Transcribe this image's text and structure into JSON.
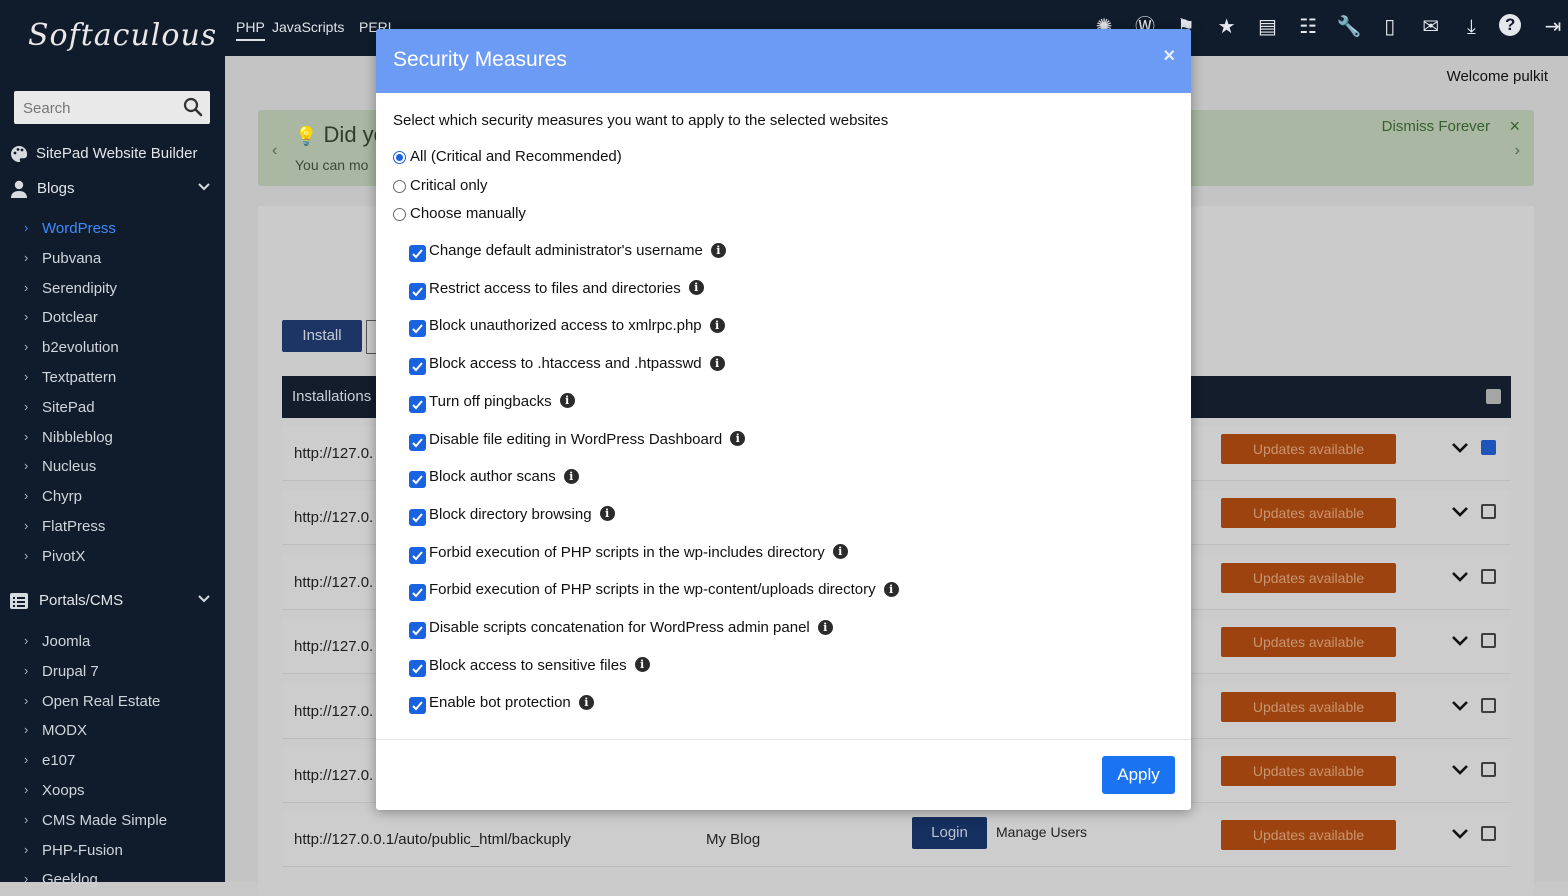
{
  "app": {
    "logo": "Softaculous",
    "welcome": "Welcome pulkit"
  },
  "topbar": {
    "tabs": [
      "PHP",
      "JavaScripts",
      "PERL"
    ],
    "icons": [
      "joomla-icon",
      "wordpress-icon",
      "flag-icon",
      "star-icon",
      "archive-icon",
      "list-icon",
      "wrench-icon",
      "file-icon",
      "mail-icon",
      "download-icon",
      "help-icon",
      "logout-icon"
    ]
  },
  "sidebar": {
    "search_placeholder": "Search",
    "categories": [
      {
        "label": "SitePad Website Builder"
      },
      {
        "label": "Blogs"
      },
      {
        "label": "Portals/CMS"
      }
    ],
    "blogs": [
      "WordPress",
      "Pubvana",
      "Serendipity",
      "Dotclear",
      "b2evolution",
      "Textpattern",
      "SitePad",
      "Nibbleblog",
      "Nucleus",
      "Chyrp",
      "FlatPress",
      "PivotX"
    ],
    "portals": [
      "Joomla",
      "Drupal 7",
      "Open Real Estate",
      "MODX",
      "e107",
      "Xoops",
      "CMS Made Simple",
      "PHP-Fusion",
      "Geeklog"
    ]
  },
  "notice": {
    "title": "Did yo",
    "text": "You can mo",
    "dismiss": "Dismiss Forever",
    "close": "×"
  },
  "main": {
    "install_label": "Install",
    "table_header": "Installations",
    "rows": [
      {
        "url": "http://127.0.",
        "updates": "Updates available",
        "checked": true
      },
      {
        "url": "http://127.0.",
        "updates": "Updates available",
        "checked": false
      },
      {
        "url": "http://127.0.",
        "updates": "Updates available",
        "checked": false
      },
      {
        "url": "http://127.0.",
        "updates": "Updates available",
        "checked": false
      },
      {
        "url": "http://127.0.",
        "updates": "Updates available",
        "checked": false
      },
      {
        "url": "http://127.0.",
        "updates": "Updates available",
        "checked": false
      },
      {
        "url": "http://127.0.0.1/auto/public_html/backuply",
        "name": "My Blog",
        "login": "Login",
        "manage": "Manage Users",
        "updates": "Updates available",
        "checked": false
      }
    ]
  },
  "modal": {
    "title": "Security Measures",
    "close": "×",
    "intro": "Select which security measures you want to apply to the selected websites",
    "radios": [
      {
        "label": "All (Critical and Recommended)",
        "selected": true
      },
      {
        "label": "Critical only",
        "selected": false
      },
      {
        "label": "Choose manually",
        "selected": false
      }
    ],
    "options": [
      "Change default administrator's username",
      "Restrict access to files and directories",
      "Block unauthorized access to xmlrpc.php",
      "Block access to .htaccess and .htpasswd",
      "Turn off pingbacks",
      "Disable file editing in WordPress Dashboard",
      "Block author scans",
      "Block directory browsing",
      "Forbid execution of PHP scripts in the wp-includes directory",
      "Forbid execution of PHP scripts in the wp-content/uploads directory",
      "Disable scripts concatenation for WordPress admin panel",
      "Block access to sensitive files",
      "Enable bot protection"
    ],
    "info_glyph": "i",
    "apply_label": "Apply"
  },
  "colors": {
    "accent": "#1a63e0",
    "modal_header": "#6c9bf6",
    "sidebar_bg": "#101c2c",
    "updates_btn": "#d9600f"
  }
}
